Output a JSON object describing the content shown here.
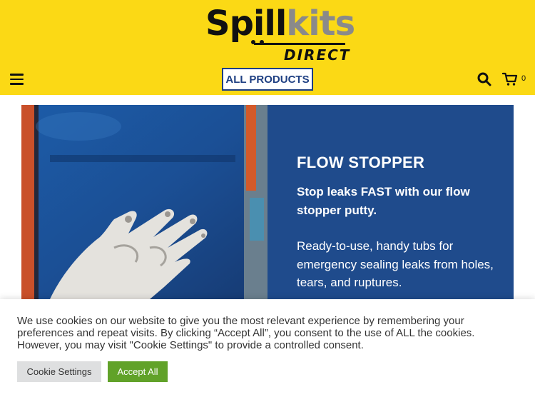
{
  "header": {
    "logo": {
      "part1": "Spi",
      "part2": "ll",
      "part3": "kits",
      "sub": "DIRECT"
    },
    "all_products_label": "ALL PRODUCTS",
    "cart_count": "0",
    "icons": [
      "menu-icon",
      "search-icon",
      "cart-icon"
    ]
  },
  "hero": {
    "title": "FLOW STOPPER",
    "subtitle": "Stop leaks FAST with our flow stopper putty.",
    "body": "Ready-to-use, handy tubs for emergency sealing leaks from holes, tears, and ruptures."
  },
  "cookie_banner": {
    "text": "We use cookies on our website to give you the most relevant experience by remembering your preferences and repeat visits. By clicking “Accept All”, you consent to the use of ALL the cookies. However, you may visit \"Cookie Settings\" to provide a controlled consent.",
    "settings_label": "Cookie Settings",
    "accept_label": "Accept All"
  },
  "colors": {
    "header_bg": "#fbd915",
    "brand_blue": "#1f4b8c",
    "accept_green": "#61a229",
    "settings_grey": "#dedfe0"
  }
}
